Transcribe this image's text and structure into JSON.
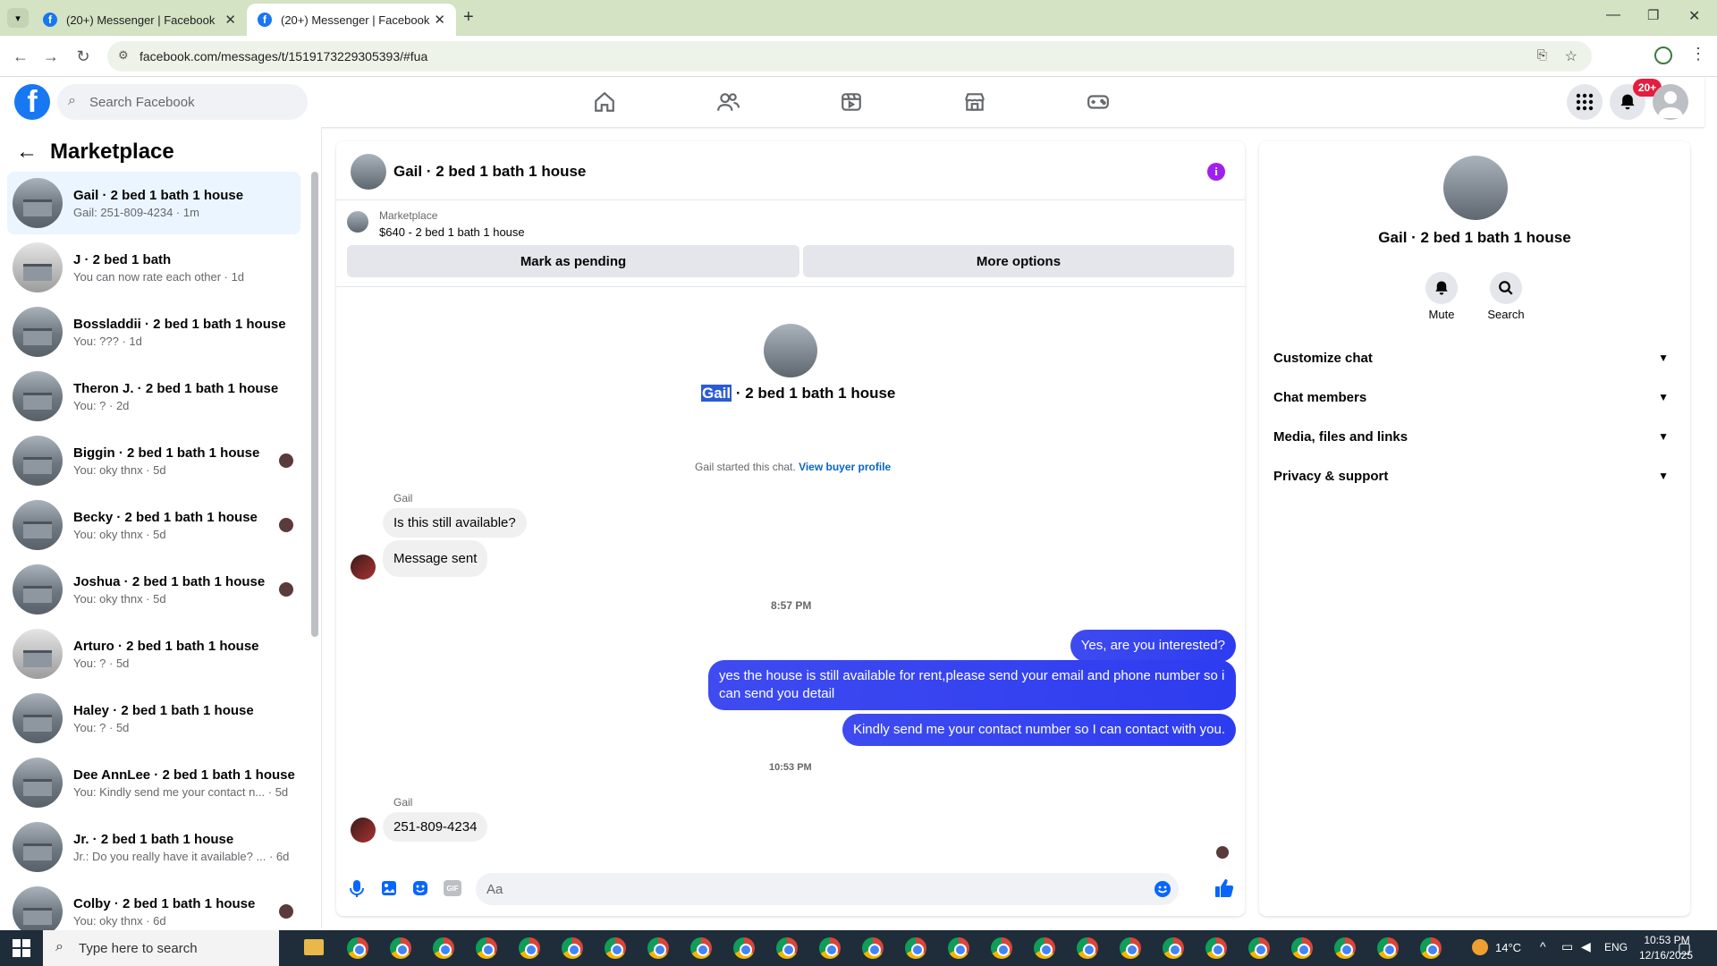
{
  "browser": {
    "tabs": [
      {
        "title": "(20+) Messenger | Facebook"
      },
      {
        "title": "(20+) Messenger | Facebook"
      }
    ],
    "url": "facebook.com/messages/t/1519173229305393/#fua"
  },
  "header": {
    "search_placeholder": "Search Facebook",
    "notification_count": "20+"
  },
  "sidebar": {
    "title": "Marketplace",
    "chats": [
      {
        "name": "Gail · 2 bed 1 bath 1 house",
        "sub": "Gail: 251-809-4234 · 1m",
        "active": true
      },
      {
        "name": "J · 2 bed 1 bath",
        "sub": "You can now rate each other · 1d"
      },
      {
        "name": "Bossladdii · 2 bed 1 bath 1 house",
        "sub": "You: ??? · 1d"
      },
      {
        "name": "Theron J. · 2 bed 1 bath 1 house",
        "sub": "You: ? · 2d"
      },
      {
        "name": "Biggin · 2 bed 1 bath 1 house",
        "sub": "You: oky thnx · 5d"
      },
      {
        "name": "Becky · 2 bed 1 bath 1 house",
        "sub": "You: oky thnx · 5d"
      },
      {
        "name": "Joshua · 2 bed 1 bath 1 house",
        "sub": "You: oky thnx · 5d"
      },
      {
        "name": "Arturo · 2 bed 1 bath 1 house",
        "sub": "You: ? · 5d"
      },
      {
        "name": "Haley · 2 bed 1 bath 1 house",
        "sub": "You: ? · 5d"
      },
      {
        "name": "Dee AnnLee · 2 bed 1 bath 1 house",
        "sub": "You: Kindly send me your contact n... · 5d"
      },
      {
        "name": "Jr. · 2 bed 1 bath 1 house",
        "sub": "Jr.: Do you really have it available? ... · 6d"
      },
      {
        "name": "Colby · 2 bed 1 bath 1 house",
        "sub": "You: oky thnx · 6d"
      }
    ]
  },
  "conversation": {
    "title": "Gail · 2 bed 1 bath 1 house",
    "listing_label": "Marketplace",
    "listing_desc": "$640 - 2 bed 1 bath 1 house",
    "mark_pending": "Mark as pending",
    "more_options": "More options",
    "intro_name_highlight": "Gail",
    "intro_name_rest": " · 2 bed 1 bath 1 house",
    "started_text": "Gail started this chat.",
    "view_buyer": "View buyer profile",
    "sender_label_1": "Gail",
    "msg_1": "Is this still available?",
    "msg_2": "Message sent",
    "time_1": "8:57 PM",
    "msg_3": "Yes, are you interested?",
    "msg_4": "yes the house is still available for rent,please send your email and phone number so i can send you detail",
    "msg_5": "Kindly send me your contact number so I can contact with you.",
    "time_2": "10:53 PM",
    "sender_label_2": "Gail",
    "msg_6": "251-809-4234",
    "composer_placeholder": "Aa"
  },
  "details": {
    "title": "Gail · 2 bed 1 bath 1 house",
    "mute": "Mute",
    "search": "Search",
    "sections": [
      "Customize chat",
      "Chat members",
      "Media, files and links",
      "Privacy & support"
    ]
  },
  "taskbar": {
    "search_placeholder": "Type here to search",
    "weather": "14°C",
    "lang": "ENG",
    "time": "10:53 PM",
    "date": "12/16/2025"
  },
  "colors": {
    "brand": "#1877f2",
    "sent_bubble": "#3e4bf0",
    "info_icon": "#a020f0",
    "badge": "#e41e3f"
  }
}
